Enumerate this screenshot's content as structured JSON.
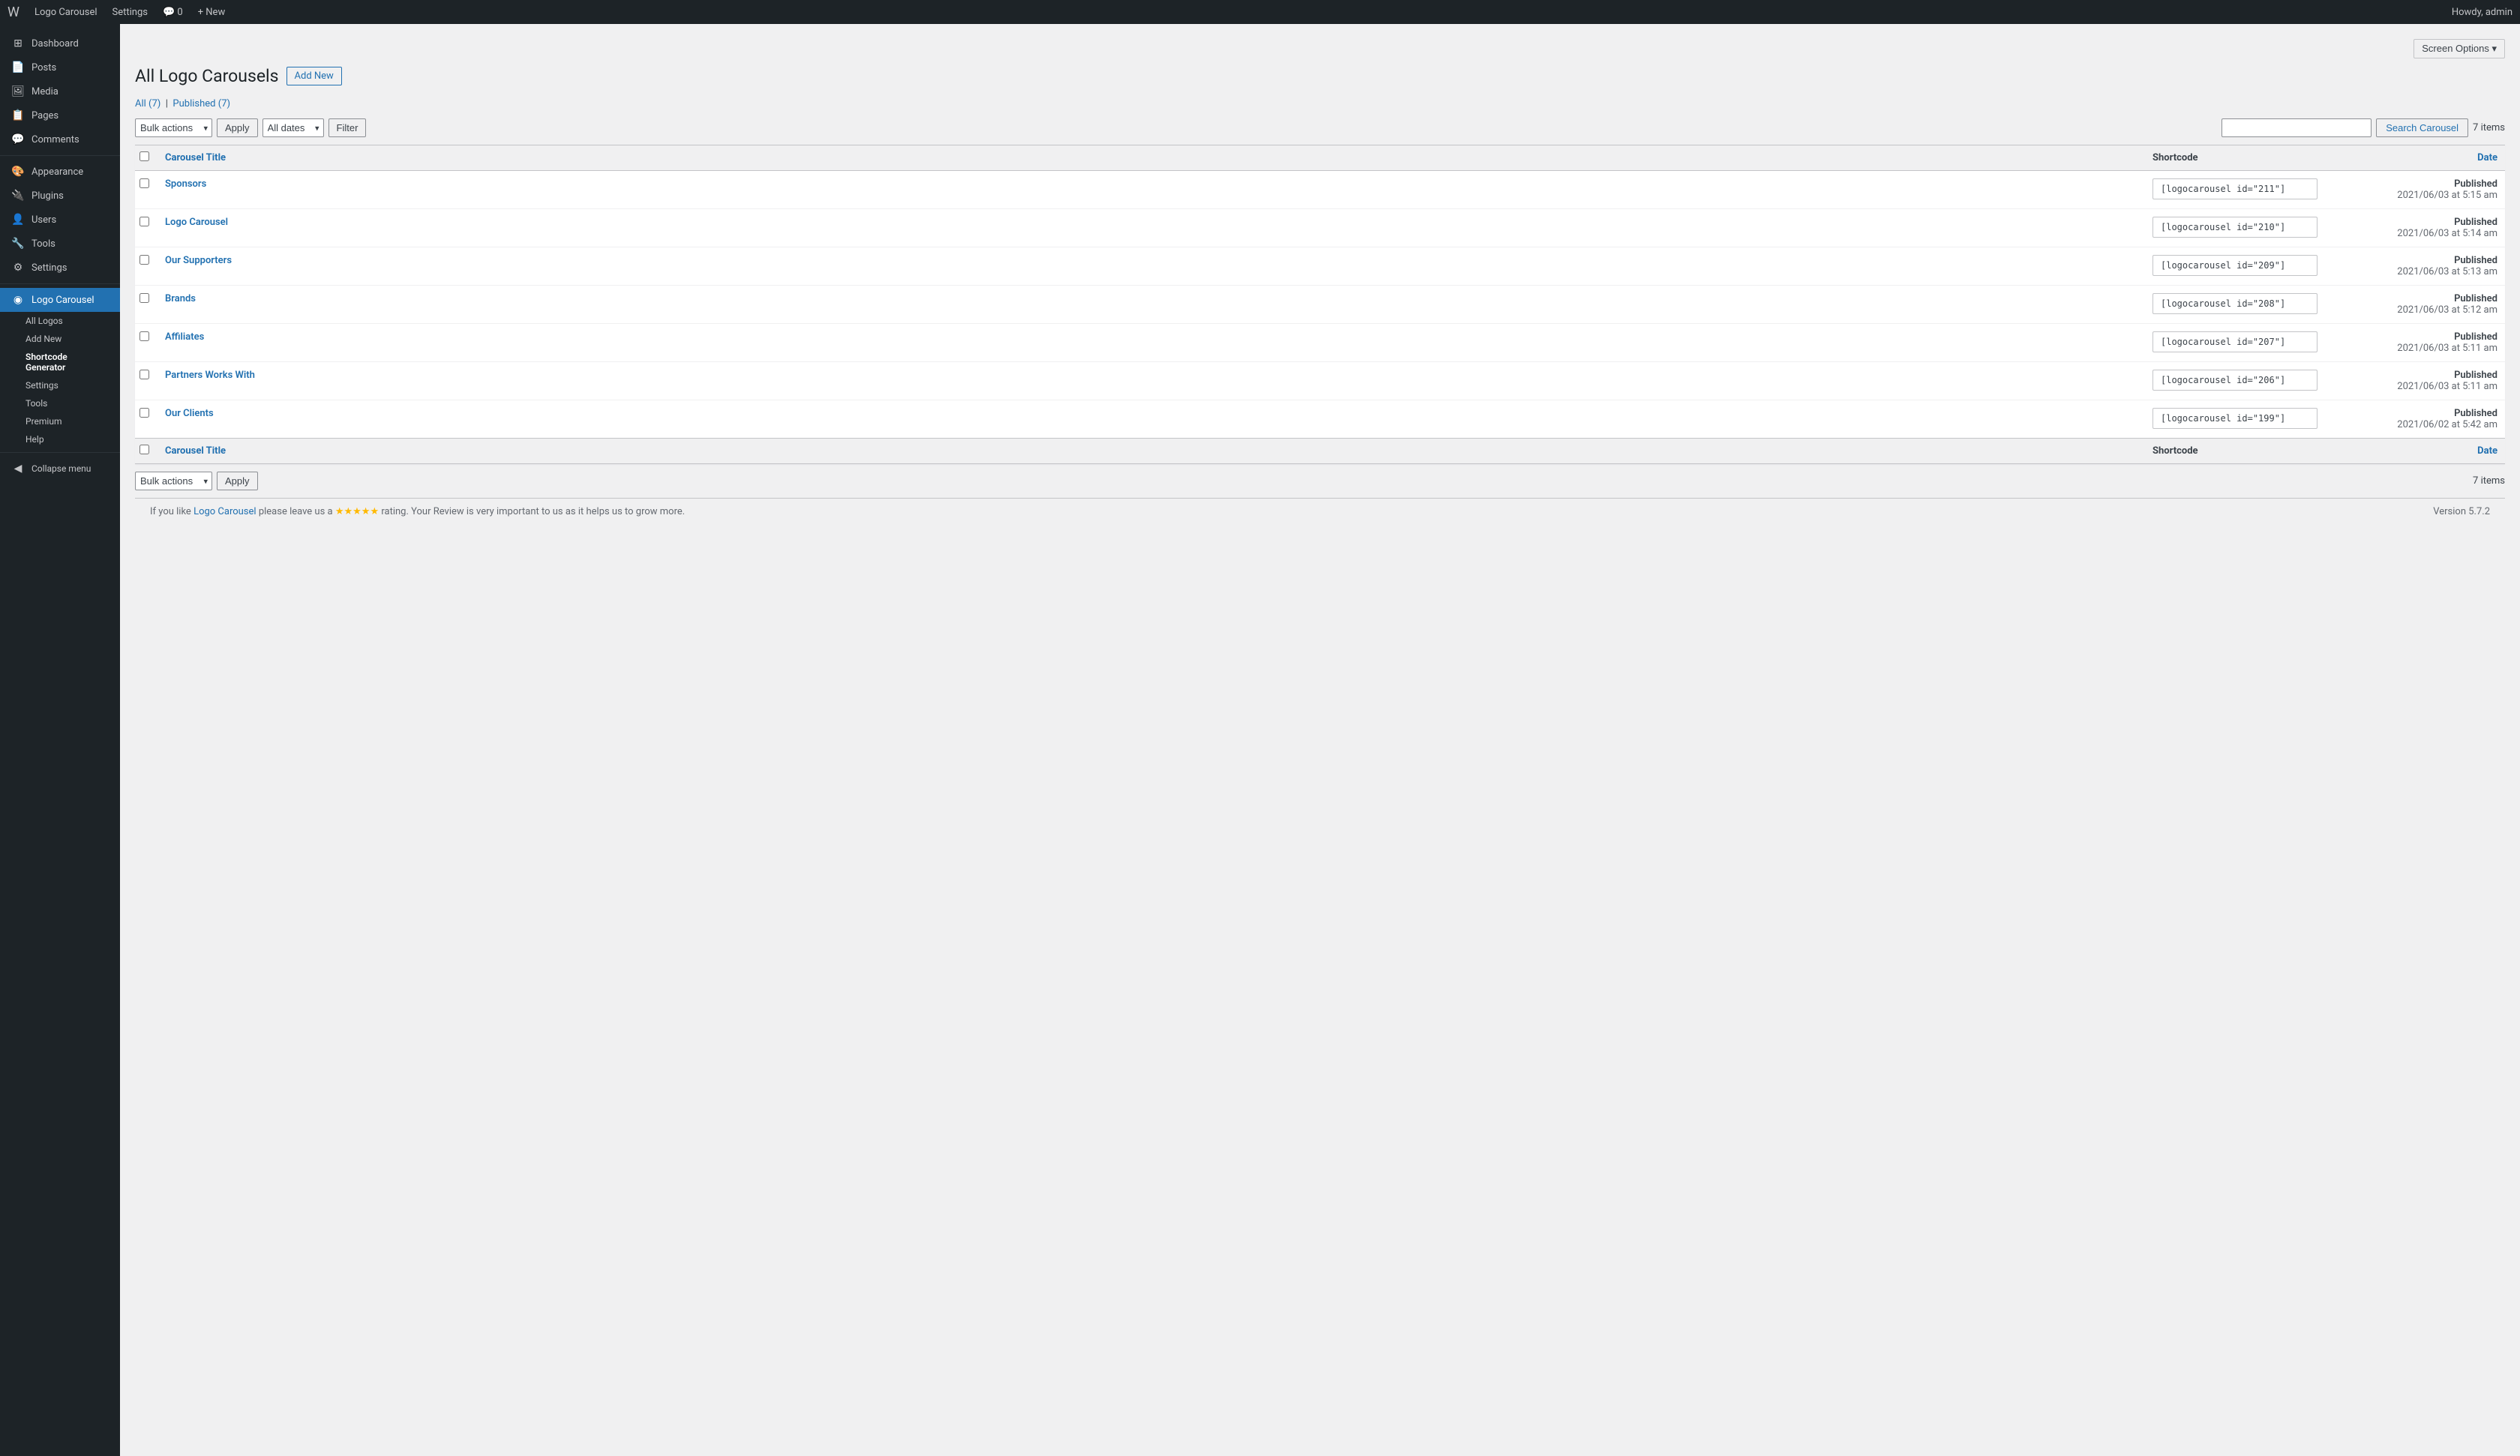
{
  "adminbar": {
    "logo": "W",
    "items": [
      {
        "label": "Logo Carousel",
        "id": "site-name"
      },
      {
        "label": "Settings",
        "id": "settings"
      },
      {
        "label": "💬 0",
        "id": "comments"
      },
      {
        "label": "+ New",
        "id": "new"
      }
    ],
    "howdy": "Howdy, admin"
  },
  "sidebar": {
    "items": [
      {
        "id": "dashboard",
        "icon": "⊞",
        "label": "Dashboard"
      },
      {
        "id": "posts",
        "icon": "📄",
        "label": "Posts"
      },
      {
        "id": "media",
        "icon": "🖼",
        "label": "Media"
      },
      {
        "id": "pages",
        "icon": "📋",
        "label": "Pages"
      },
      {
        "id": "comments",
        "icon": "💬",
        "label": "Comments"
      },
      {
        "id": "appearance",
        "icon": "🎨",
        "label": "Appearance"
      },
      {
        "id": "plugins",
        "icon": "🔌",
        "label": "Plugins"
      },
      {
        "id": "users",
        "icon": "👤",
        "label": "Users"
      },
      {
        "id": "tools",
        "icon": "🔧",
        "label": "Tools"
      },
      {
        "id": "settings",
        "icon": "⚙",
        "label": "Settings"
      },
      {
        "id": "logo-carousel",
        "icon": "◉",
        "label": "Logo Carousel",
        "current": true
      }
    ],
    "submenu": [
      {
        "id": "all-logos",
        "label": "All Logos"
      },
      {
        "id": "add-new",
        "label": "Add New"
      },
      {
        "id": "shortcode-generator",
        "label": "Shortcode Generator",
        "current": true
      },
      {
        "id": "sub-settings",
        "label": "Settings"
      },
      {
        "id": "sub-tools",
        "label": "Tools"
      },
      {
        "id": "premium",
        "label": "Premium"
      },
      {
        "id": "help",
        "label": "Help"
      }
    ],
    "collapse": "Collapse menu"
  },
  "screen_options": "Screen Options ▾",
  "page": {
    "title": "All Logo Carousels",
    "add_new": "Add New"
  },
  "filter_links": {
    "all_label": "All",
    "all_count": "(7)",
    "published_label": "Published",
    "published_count": "(7)"
  },
  "search": {
    "placeholder": "",
    "button": "Search Carousel"
  },
  "tablenav_top": {
    "bulk_actions_label": "Bulk actions",
    "apply_label": "Apply",
    "dates_label": "All dates",
    "filter_label": "Filter",
    "items_count": "7 items"
  },
  "table": {
    "col_title": "Carousel Title",
    "col_shortcode": "Shortcode",
    "col_date": "Date",
    "rows": [
      {
        "id": 1,
        "title": "Sponsors",
        "shortcode": "[logocarousel id=\"211\"]",
        "status": "Published",
        "date": "2021/06/03 at 5:15 am"
      },
      {
        "id": 2,
        "title": "Logo Carousel",
        "shortcode": "[logocarousel id=\"210\"]",
        "status": "Published",
        "date": "2021/06/03 at 5:14 am"
      },
      {
        "id": 3,
        "title": "Our Supporters",
        "shortcode": "[logocarousel id=\"209\"]",
        "status": "Published",
        "date": "2021/06/03 at 5:13 am"
      },
      {
        "id": 4,
        "title": "Brands",
        "shortcode": "[logocarousel id=\"208\"]",
        "status": "Published",
        "date": "2021/06/03 at 5:12 am"
      },
      {
        "id": 5,
        "title": "Affiliates",
        "shortcode": "[logocarousel id=\"207\"]",
        "status": "Published",
        "date": "2021/06/03 at 5:11 am"
      },
      {
        "id": 6,
        "title": "Partners Works With",
        "shortcode": "[logocarousel id=\"206\"]",
        "status": "Published",
        "date": "2021/06/03 at 5:11 am"
      },
      {
        "id": 7,
        "title": "Our Clients",
        "shortcode": "[logocarousel id=\"199\"]",
        "status": "Published",
        "date": "2021/06/02 at 5:42 am"
      }
    ]
  },
  "tablenav_bottom": {
    "bulk_actions_label": "Bulk actions",
    "apply_label": "Apply",
    "items_count": "7 items"
  },
  "footer": {
    "text_prefix": "If you like",
    "plugin_name": "Logo Carousel",
    "text_middle": "please leave us a",
    "stars": "★★★★★",
    "text_suffix": "rating. Your Review is very important to us as it helps us to grow more.",
    "version": "Version 5.7.2"
  }
}
